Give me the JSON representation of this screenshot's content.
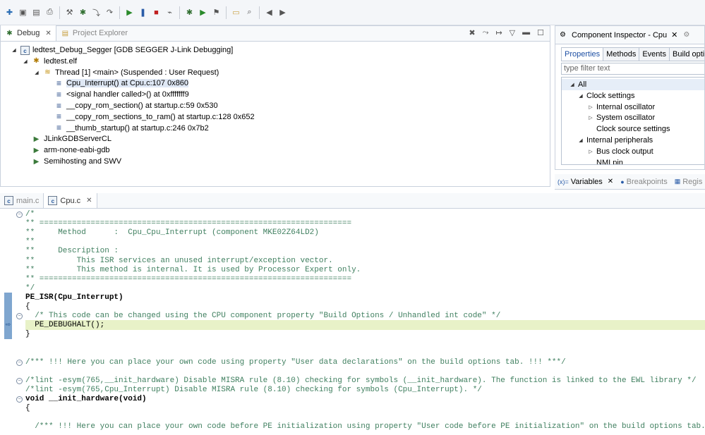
{
  "toolbar": {
    "icons": [
      "new-icon",
      "save-icon",
      "save-all-icon",
      "print-icon",
      "build-icon",
      "debug-icon",
      "step-into-icon",
      "step-over-icon",
      "resume-icon",
      "suspend-icon",
      "terminate-icon",
      "disconnect-icon",
      "debug-config-icon",
      "run-icon",
      "external-tools-icon",
      "open-folder-icon",
      "search-icon",
      "back-icon",
      "forward-icon"
    ]
  },
  "debug_panel": {
    "tabs": [
      {
        "label": "Debug",
        "active": true
      },
      {
        "label": "Project Explorer",
        "active": false
      }
    ],
    "tree": [
      {
        "label": "ledtest_Debug_Segger [GDB SEGGER J-Link Debugging]",
        "depth": 0,
        "icon": "launch"
      },
      {
        "label": "ledtest.elf",
        "depth": 1,
        "icon": "elf"
      },
      {
        "label": "Thread [1] <main> (Suspended : User Request)",
        "depth": 2,
        "icon": "thread"
      },
      {
        "label": "Cpu_Interrupt() at Cpu.c:107 0x860",
        "depth": 3,
        "icon": "frame",
        "selected": true
      },
      {
        "label": "<signal handler called>() at 0xfffffff9",
        "depth": 3,
        "icon": "frame"
      },
      {
        "label": "__copy_rom_section() at startup.c:59 0x530",
        "depth": 3,
        "icon": "frame"
      },
      {
        "label": "__copy_rom_sections_to_ram() at startup.c:128 0x652",
        "depth": 3,
        "icon": "frame"
      },
      {
        "label": "__thumb_startup() at startup.c:246 0x7b2",
        "depth": 3,
        "icon": "frame"
      },
      {
        "label": "JLinkGDBServerCL",
        "depth": 1,
        "icon": "proc"
      },
      {
        "label": "arm-none-eabi-gdb",
        "depth": 1,
        "icon": "proc"
      },
      {
        "label": "Semihosting and SWV",
        "depth": 1,
        "icon": "proc"
      }
    ]
  },
  "component_inspector": {
    "title": "Component Inspector - Cpu",
    "subtabs": [
      "Properties",
      "Methods",
      "Events",
      "Build optio"
    ],
    "filter_placeholder": "type filter text",
    "tree": [
      {
        "label": "All",
        "depth": 0,
        "twisty": "open"
      },
      {
        "label": "Clock settings",
        "depth": 1,
        "twisty": "open"
      },
      {
        "label": "Internal oscillator",
        "depth": 2,
        "twisty": "closed"
      },
      {
        "label": "System oscillator",
        "depth": 2,
        "twisty": "closed"
      },
      {
        "label": "Clock source settings",
        "depth": 2,
        "twisty": "none"
      },
      {
        "label": "Internal peripherals",
        "depth": 1,
        "twisty": "open"
      },
      {
        "label": "Bus clock output",
        "depth": 2,
        "twisty": "closed"
      },
      {
        "label": "NMI pin",
        "depth": 2,
        "twisty": "none"
      }
    ]
  },
  "bottom_right_tabs": [
    {
      "label": "Variables",
      "active": true
    },
    {
      "label": "Breakpoints",
      "active": false
    },
    {
      "label": "Regis",
      "active": false
    }
  ],
  "editor": {
    "tabs": [
      {
        "label": "main.c",
        "active": false
      },
      {
        "label": "Cpu.c",
        "active": true
      }
    ],
    "lines": [
      {
        "text": "/*",
        "style": "comment"
      },
      {
        "text": "** ===================================================================",
        "style": "comment"
      },
      {
        "text": "**     Method      :  Cpu_Cpu_Interrupt (component MKE02Z64LD2)",
        "style": "comment"
      },
      {
        "text": "**",
        "style": "comment"
      },
      {
        "text": "**     Description :",
        "style": "comment"
      },
      {
        "text": "**         This ISR services an unused interrupt/exception vector.",
        "style": "comment"
      },
      {
        "text": "**         This method is internal. It is used by Processor Expert only.",
        "style": "comment"
      },
      {
        "text": "** ===================================================================",
        "style": "comment"
      },
      {
        "text": "*/",
        "style": "comment"
      },
      {
        "text": "PE_ISR(Cpu_Interrupt)",
        "style": "code"
      },
      {
        "text": "{",
        "style": "code"
      },
      {
        "text": "  /* This code can be changed using the CPU component property \"Build Options / Unhandled int code\" */",
        "style": "comment"
      },
      {
        "text": "  PE_DEBUGHALT();",
        "style": "code"
      },
      {
        "text": "}",
        "style": "code"
      },
      {
        "text": "",
        "style": "code"
      },
      {
        "text": "",
        "style": "code"
      },
      {
        "text": "/*** !!! Here you can place your own code using property \"User data declarations\" on the build options tab. !!! ***/",
        "style": "comment"
      },
      {
        "text": "",
        "style": "code"
      },
      {
        "text": "/*lint -esym(765,__init_hardware) Disable MISRA rule (8.10) checking for symbols (__init_hardware). The function is linked to the EWL library */",
        "style": "comment"
      },
      {
        "text": "/*lint -esym(765,Cpu_Interrupt) Disable MISRA rule (8.10) checking for symbols (Cpu_Interrupt). */",
        "style": "comment"
      },
      {
        "text": "void __init_hardware(void)",
        "style": "kwcode"
      },
      {
        "text": "{",
        "style": "code"
      },
      {
        "text": "",
        "style": "code"
      },
      {
        "text": "  /*** !!! Here you can place your own code before PE initialization using property \"User code before PE initialization\" on the build options tab. !!! ***/",
        "style": "comment"
      }
    ]
  }
}
